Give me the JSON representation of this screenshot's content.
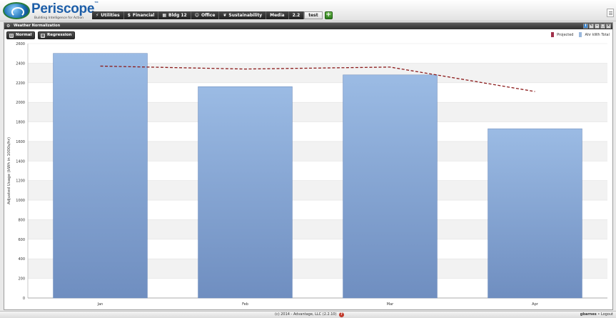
{
  "app": {
    "logo_name": "Periscope",
    "logo_tm": "™",
    "logo_tagline": "Building Intelligence for Action"
  },
  "tabs": [
    {
      "label": "Utilities",
      "icon": "lightning-icon",
      "glyph": "⚡"
    },
    {
      "label": "Financial",
      "icon": "dollar-icon",
      "glyph": "$"
    },
    {
      "label": "Bldg 12",
      "icon": "building-icon",
      "glyph": "▦"
    },
    {
      "label": "Office",
      "icon": "users-icon",
      "glyph": "☺"
    },
    {
      "label": "Sustainability",
      "icon": "leaf-icon",
      "glyph": "❦"
    },
    {
      "label": "Media",
      "icon": "",
      "glyph": ""
    },
    {
      "label": "2.2",
      "icon": "",
      "glyph": ""
    },
    {
      "label": "test",
      "icon": "",
      "glyph": "",
      "active": true
    }
  ],
  "tab_add_label": "+",
  "panel": {
    "title": "Weather Normalization",
    "buttons": {
      "normal": "Normal",
      "regression": "Regression"
    },
    "legend": [
      {
        "label": "Projected",
        "color": "#a0304a"
      },
      {
        "label": "Ahr kWh Total",
        "color": "#9ab8dc"
      }
    ]
  },
  "chart_data": {
    "type": "bar",
    "categories": [
      "Jan",
      "Feb",
      "Mar",
      "Apr"
    ],
    "series": [
      {
        "name": "Ahr kWh Total",
        "type": "bar",
        "values": [
          2500,
          2160,
          2280,
          1730
        ],
        "color": "#7d9fcd"
      },
      {
        "name": "Projected",
        "type": "line",
        "values": [
          2370,
          2340,
          2360,
          2110
        ],
        "color": "#8b1a1a",
        "dashed": true
      }
    ],
    "ylabel": "Adjusted Usage (kWh in 1000s/hr)",
    "ylim": [
      0,
      2600
    ],
    "yticks": [
      0,
      200,
      400,
      600,
      800,
      1000,
      1200,
      1400,
      1600,
      1800,
      2000,
      2200,
      2400,
      2600
    ],
    "grid": true,
    "legend_position": "top-right"
  },
  "footer": {
    "copyright": "(c) 2014 - Advantage, LLC (2.2.10)",
    "help": "?",
    "user": "gbarnes",
    "logout": "Logout"
  }
}
